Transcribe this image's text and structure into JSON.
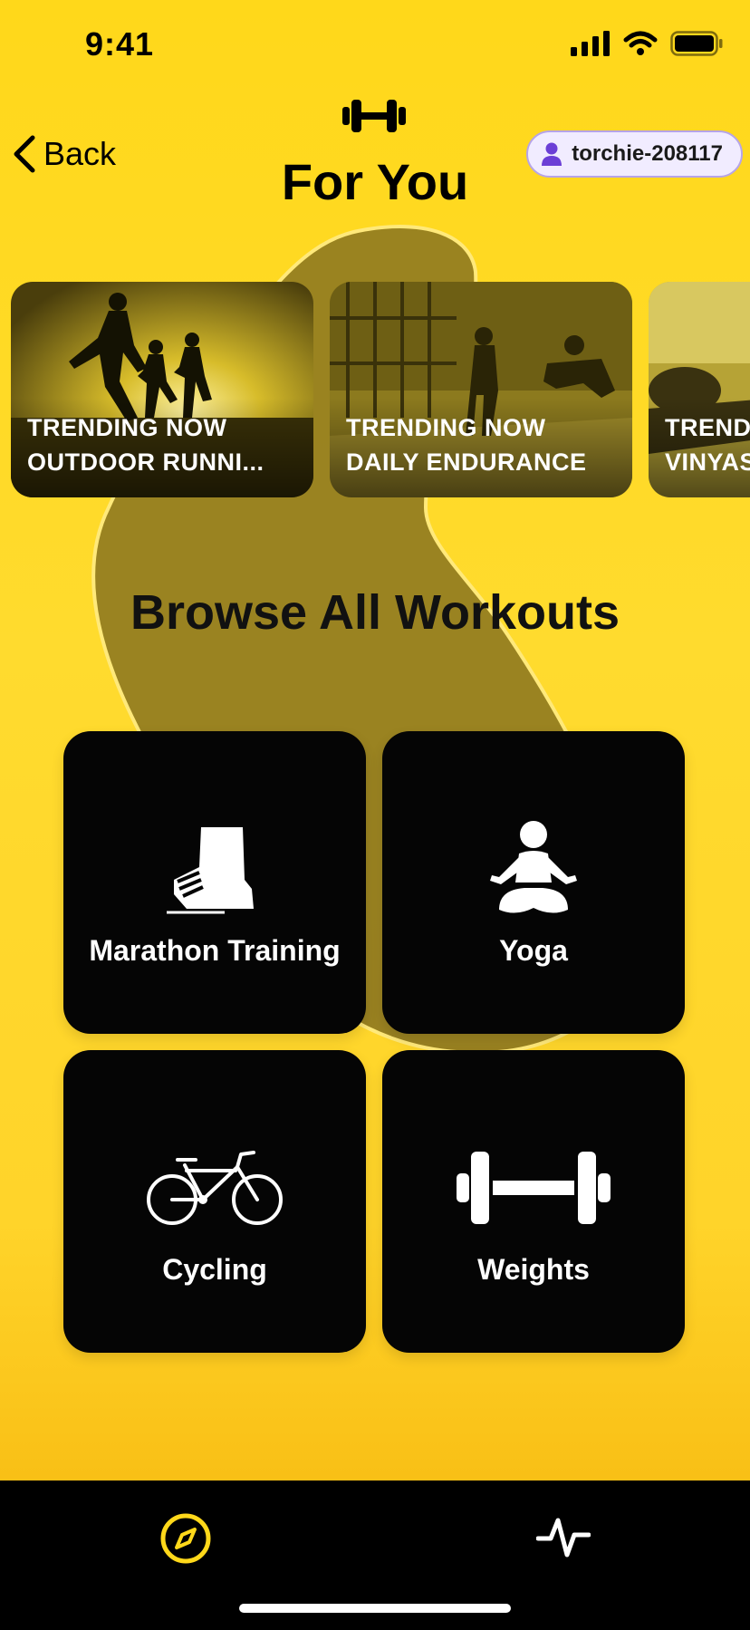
{
  "status_bar": {
    "time": "9:41"
  },
  "header": {
    "back_label": "Back",
    "title": "For You",
    "user_badge": "torchie-208117"
  },
  "trending": [
    {
      "line1": "TRENDING NOW",
      "line2": "OUTDOOR RUNNI..."
    },
    {
      "line1": "TRENDING NOW",
      "line2": "DAILY ENDURANCE"
    },
    {
      "line1": "TREND",
      "line2": "VINYAS"
    }
  ],
  "browse": {
    "title": "Browse All Workouts",
    "tiles": [
      {
        "label": "Marathon Training",
        "icon": "running-shoe-icon"
      },
      {
        "label": "Yoga",
        "icon": "meditation-icon"
      },
      {
        "label": "Cycling",
        "icon": "bicycle-icon"
      },
      {
        "label": "Weights",
        "icon": "dumbbell-icon"
      }
    ]
  },
  "tab_bar": {
    "items": [
      "compass-icon",
      "activity-icon"
    ]
  },
  "colors": {
    "background": "#FFD81A",
    "tile": "#050505",
    "badge_bg": "#F1ECFF",
    "badge_icon": "#6B3FD6"
  }
}
